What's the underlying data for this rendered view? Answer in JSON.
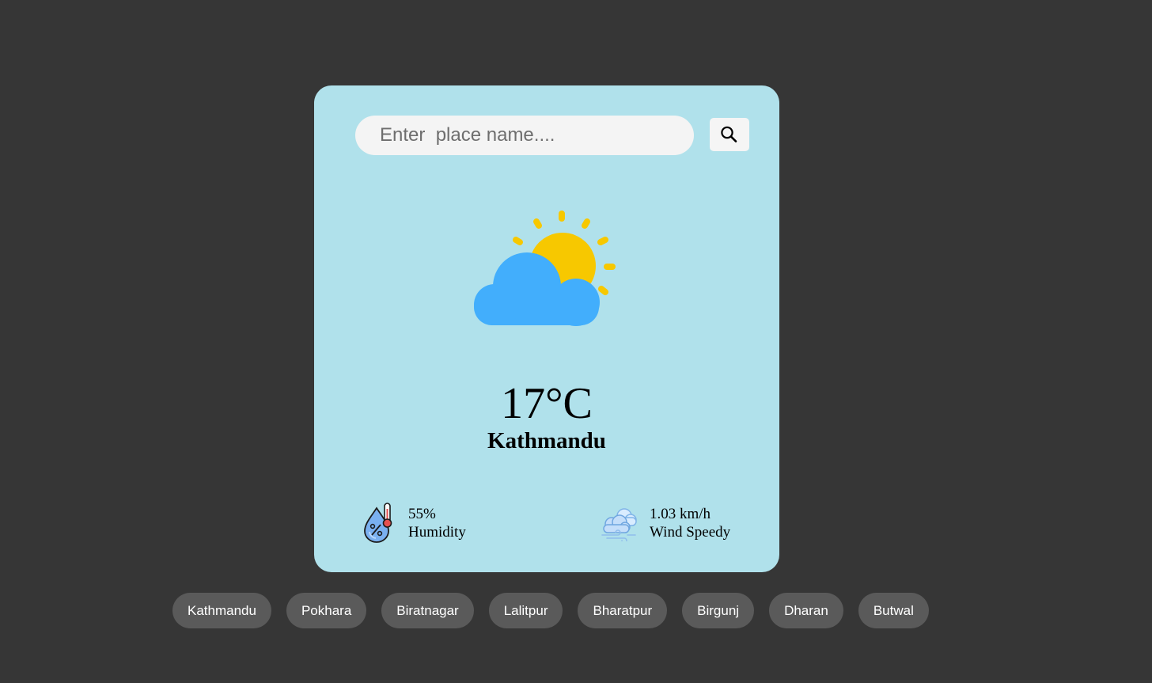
{
  "search": {
    "placeholder": "Enter  place name....",
    "value": "",
    "button_icon": "search-icon"
  },
  "weather": {
    "icon": "partly-cloudy-icon",
    "temperature": "17°C",
    "city": "Kathmandu"
  },
  "humidity": {
    "icon": "humidity-icon",
    "value": "55%",
    "label": "Humidity"
  },
  "wind": {
    "icon": "wind-icon",
    "value": "1.03 km/h",
    "label": "Wind Speedy"
  },
  "cities": [
    "Kathmandu",
    "Pokhara",
    "Biratnagar",
    "Lalitpur",
    "Bharatpur",
    "Birgunj",
    "Dharan",
    "Butwal"
  ],
  "colors": {
    "background": "#363636",
    "card": "#b0e1eb",
    "chip": "#5a5a5a",
    "sun": "#f7c800",
    "cloud": "#42aefc"
  }
}
